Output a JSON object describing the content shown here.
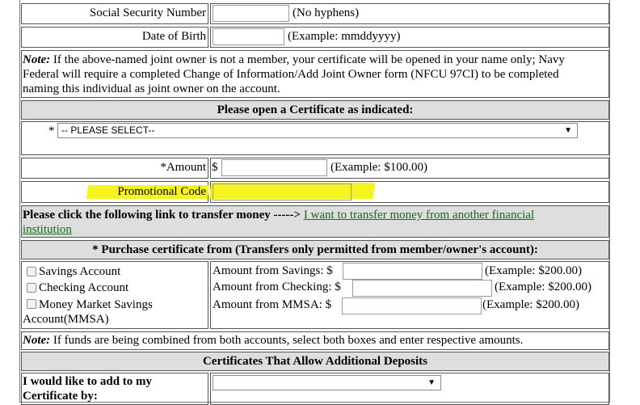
{
  "ssn": {
    "label": "Social Security Number",
    "hint": "(No hyphens)"
  },
  "dob": {
    "label": "Date of Birth",
    "hint": "(Example: mmddyyyy)"
  },
  "note1": {
    "prefix": "Note:",
    "line1": " If the above-named joint owner is not a member, your certificate will be opened in your name only; Navy",
    "line2": "Federal will require a completed Change of Information/Add Joint Owner form (NFCU 97CI) to be completed",
    "line3": "naming this individual as joint owner on the account."
  },
  "open_header": "Please open a Certificate as indicated:",
  "cert_select": {
    "asterisk": "*",
    "value": "-- PLEASE SELECT--"
  },
  "amount": {
    "label": "*Amount",
    "currency": "$",
    "hint": "(Example: $100.00)"
  },
  "promo": {
    "label": "Promotional Code"
  },
  "transfer": {
    "text": "Please click the following link to transfer money ----->",
    "link_line1": "I want to transfer money from another financial",
    "link_line2": "institution"
  },
  "purchase_header": "* Purchase certificate from (Transfers only permitted from member/owner's account):",
  "accounts": [
    {
      "label": "Savings Account"
    },
    {
      "label": "Checking Account"
    },
    {
      "label": "Money Market Savings"
    }
  ],
  "account_cont": "Account(MMSA)",
  "amounts_from": [
    {
      "label": "Amount from Savings: $",
      "hint": "(Example: $200.00)"
    },
    {
      "label": "Amount from Checking: $",
      "hint": "(Example: $200.00)"
    },
    {
      "label": "Amount from MMSA: $",
      "hint": "(Example: $200.00)"
    }
  ],
  "note2": {
    "prefix": "Note:",
    "text": " If funds are being combined from both accounts, select both boxes and enter respective amounts."
  },
  "additional_header": "Certificates That Allow Additional Deposits",
  "add_to": {
    "line1": "I would like to add to my",
    "line2": "Certificate by:"
  },
  "colors": {
    "highlight": "#f7f31e",
    "header_bg": "#dedede",
    "link": "#1a6a1a"
  }
}
